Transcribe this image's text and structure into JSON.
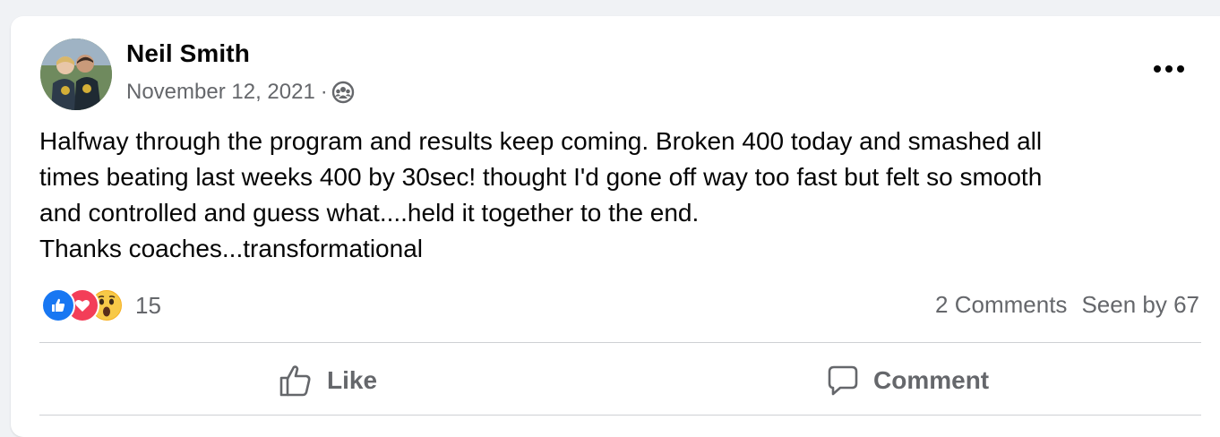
{
  "post": {
    "author": "Neil Smith",
    "date": "November 12, 2021",
    "separator": "·",
    "audience_icon": "group-audience-icon",
    "more_icon": "more-options-icon",
    "text_lines": [
      "Halfway through the program and results keep coming. Broken 400 today and smashed all",
      "times beating last weeks 400 by 30sec! thought I'd gone off way too fast but felt so smooth",
      "and controlled and guess what....held it together to the end.",
      "Thanks coaches...transformational"
    ]
  },
  "reactions": {
    "icons": [
      "like-reaction-icon",
      "love-reaction-icon",
      "wow-reaction-icon"
    ],
    "count": "15"
  },
  "stats": {
    "comments": "2 Comments",
    "seen_by": "Seen by 67"
  },
  "actions": {
    "like_label": "Like",
    "comment_label": "Comment"
  },
  "colors": {
    "like_blue": "#1877f2",
    "love_red": "#f33e58",
    "wow_yellow": "#f7b125",
    "secondary_text": "#65676b",
    "primary_text": "#050505"
  }
}
